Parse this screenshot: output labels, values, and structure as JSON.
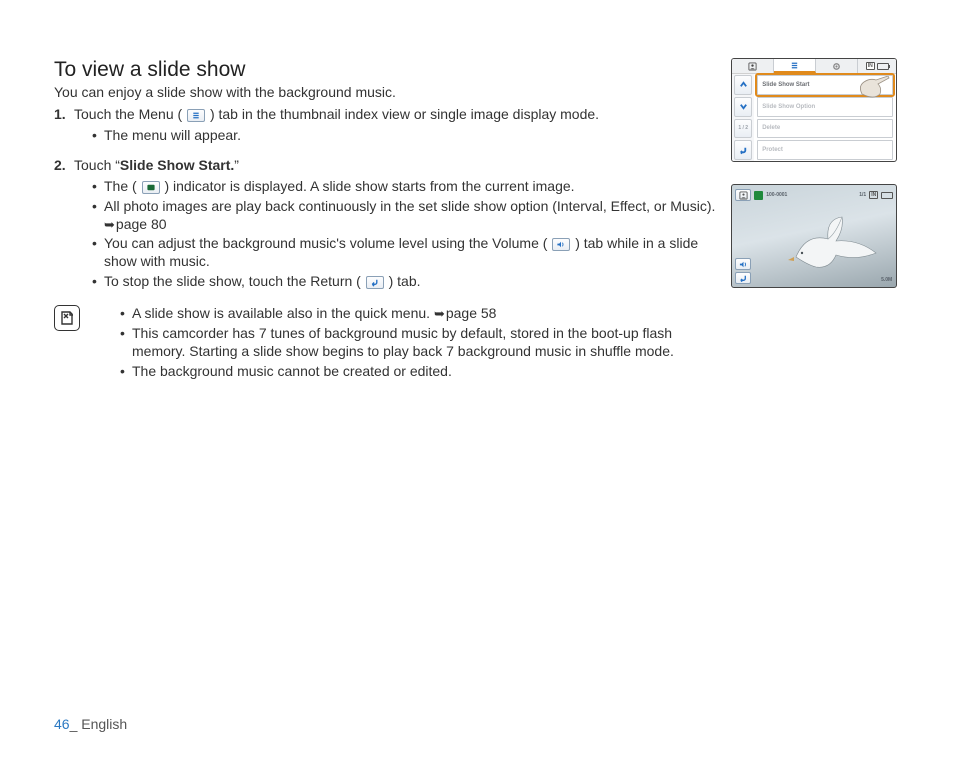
{
  "title": "To view a slide show",
  "intro": "You can enjoy a slide show with the background music.",
  "step1": {
    "text_a": "Touch the Menu (",
    "text_b": ") tab in the thumbnail index view or single image display mode.",
    "bullets": [
      "The menu will appear."
    ]
  },
  "step2": {
    "text_a": "Touch “",
    "bold": "Slide Show Start.",
    "text_b": "”",
    "bullets": {
      "b1_a": "The (",
      "b1_b": ") indicator is displayed. A slide show starts from the current image.",
      "b2": "All photo images are play back continuously in the set slide show option (Interval, Effect, or Music). ",
      "b2_ref": "page 80",
      "b3_a": "You can adjust the background music's volume level using the Volume (",
      "b3_b": ") tab while in a slide show with music.",
      "b4_a": "To stop the slide show, touch the Return (",
      "b4_b": ") tab."
    }
  },
  "note": {
    "n1": "A slide show is available also in the quick menu. ",
    "n1_ref": "page 58",
    "n2": "This camcorder has 7 tunes of background music by default, stored in the boot-up flash memory. Starting a slide show begins to play back 7 background music in shuffle mode.",
    "n3": "The background music cannot be created or edited."
  },
  "footer": {
    "page_num": "46",
    "sep": "_ ",
    "lang": "English"
  },
  "screen1": {
    "status_in": "IN",
    "page_indicator": "1 / 2",
    "rows": [
      "Slide Show Start",
      "Slide Show Option",
      "Delete",
      "Protect"
    ]
  },
  "screen2": {
    "counter": "100-0001",
    "page": "1/1",
    "status_in": "IN",
    "res": "5.0M"
  }
}
